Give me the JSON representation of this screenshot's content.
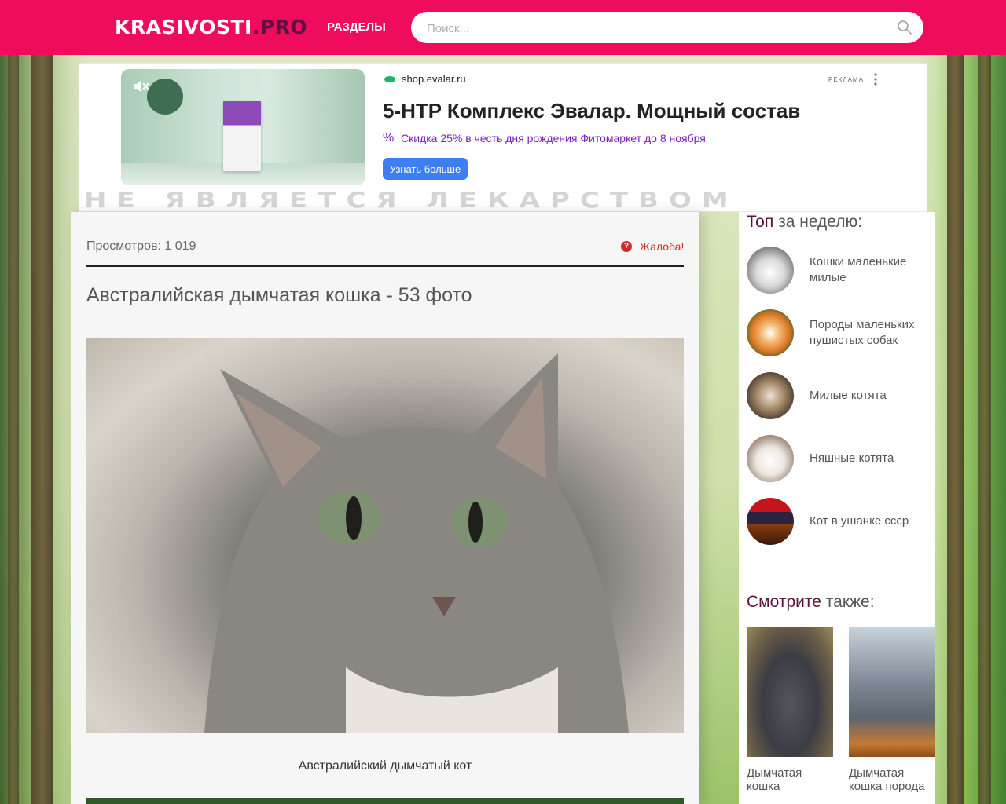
{
  "header": {
    "logo_part1": "KRASIVOSTI",
    "logo_part2": ".PRO",
    "nav_sections": "РАЗДЕЛЫ",
    "search_placeholder": "Поиск...",
    "brand_color": "#f00c5c"
  },
  "ad": {
    "domain": "shop.evalar.ru",
    "label": "РЕКЛАМА",
    "title": "5-HTP Комплекс Эвалар. Мощный состав",
    "promo": "Скидка 25% в честь дня рождения Фитомаркет до 8 ноября",
    "button": "Узнать больше",
    "disclaimer": "НЕ ЯВЛЯЕТСЯ ЛЕКАРСТВОМ"
  },
  "article": {
    "views": "Просмотров: 1 019",
    "complain": "Жалоба!",
    "title": "Австралийская дымчатая кошка - 53 фото",
    "caption": "Австралийский дымчатый кот"
  },
  "sidebar": {
    "top_heading_hl": "Топ",
    "top_heading_rest": " за неделю:",
    "top_items": [
      {
        "label": "Кошки маленькие милые"
      },
      {
        "label": "Породы маленьких пушистых собак"
      },
      {
        "label": "Милые котята"
      },
      {
        "label": "Няшные котята"
      },
      {
        "label": "Кот в ушанке ссср"
      }
    ],
    "see_heading_hl": "Смотрите",
    "see_heading_rest": " также:",
    "see_items": [
      {
        "label": "Дымчатая кошка"
      },
      {
        "label": "Дымчатая кошка порода"
      }
    ]
  }
}
